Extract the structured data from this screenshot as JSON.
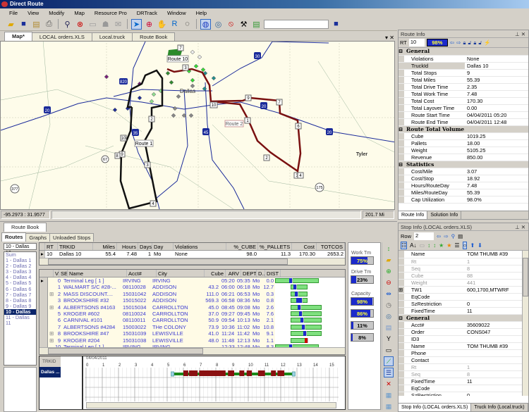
{
  "app": {
    "title": "Direct Route"
  },
  "menu": [
    "File",
    "View",
    "Modify",
    "Map",
    "Resource Pro",
    "DRTrack",
    "Window",
    "Help"
  ],
  "toolbar": {
    "combo_value": ""
  },
  "doc_tabs": [
    "Map*",
    "LOCAL orders.XLS",
    "Local.truck",
    "Route Book"
  ],
  "map": {
    "labels": {
      "route10": "Route 10",
      "route1": "Route 1",
      "route2": "Route 2",
      "dallas": "Dallas",
      "tyler": "Tyler"
    },
    "shields": {
      "i30": "30",
      "i820": "820",
      "i20a": "20",
      "i20b": "20",
      "i20c": "20",
      "i35": "35",
      "i45": "45",
      "us67": "67",
      "us377": "377",
      "us175": "175"
    },
    "route1_stops": [
      "10",
      "9",
      "8",
      "3",
      "4",
      "6",
      "2",
      "1"
    ],
    "route2_stops": [
      "10",
      "9",
      "7",
      "1",
      "6",
      "2",
      "3",
      "4"
    ],
    "route10_stops": [
      "7",
      "3"
    ]
  },
  "status": {
    "coords": "-95.2973 : 31.9577",
    "scale": "201.7 Mi"
  },
  "route_info": {
    "title": "Route Info",
    "rt_label": "RT",
    "rt_value": "10",
    "cap_pct": "98%",
    "sections": [
      {
        "name": "General",
        "rows": [
          [
            "Violations",
            "None"
          ],
          [
            "TruckId",
            "Dallas 10"
          ],
          [
            "Total Stops",
            "9"
          ],
          [
            "Total Miles",
            "55.39"
          ],
          [
            "Total Drive Time",
            "2.35"
          ],
          [
            "Total Work Time",
            "7.48"
          ],
          [
            "Total Cost",
            "170.30"
          ],
          [
            "Total Layover Time",
            "0.00"
          ],
          [
            "Route Start Time",
            "04/04/2011 05:20"
          ],
          [
            "Route End Time",
            "04/04/2011 12:48"
          ]
        ]
      },
      {
        "name": "Route Total Volume",
        "rows": [
          [
            "Cube",
            "1019.25"
          ],
          [
            "Pallets",
            "18.00"
          ],
          [
            "Weight",
            "5105.25"
          ],
          [
            "Revenue",
            "850.00"
          ]
        ]
      },
      {
        "name": "Statistics",
        "rows": [
          [
            "Cost/Mile",
            "3.07"
          ],
          [
            "Cost/Stop",
            "18.92"
          ],
          [
            "Hours/RouteDay",
            "7.48"
          ],
          [
            "Miles/RouteDay",
            "55.39"
          ],
          [
            "Cap Utilization",
            "98.0%"
          ]
        ]
      }
    ],
    "tabs": [
      "Route Info",
      "Solution Info"
    ]
  },
  "stop_info": {
    "title": "Stop Info (LOCAL orders.XLS)",
    "row_label": "Row",
    "row_value": "2",
    "top_rows": [
      [
        "Name",
        "TOM THUMB #39",
        0
      ],
      [
        "Rt",
        "1",
        1
      ],
      [
        "Seq",
        "8",
        1
      ],
      [
        "Cube",
        "88",
        1
      ],
      [
        "Weight",
        "441",
        1
      ],
      [
        "TW1",
        "600,1700,MTWRF",
        0
      ],
      [
        "EqCode",
        "",
        0
      ],
      [
        "SzRestriction",
        "0",
        0
      ],
      [
        "FixedTime",
        "11",
        0
      ]
    ],
    "section": "General",
    "gen_rows": [
      [
        "Acct#",
        "35609022",
        0
      ],
      [
        "Order",
        "CONS047",
        0
      ],
      [
        "ID3",
        "",
        0
      ],
      [
        "Name",
        "TOM THUMB #39",
        0
      ],
      [
        "Phone",
        "",
        0
      ],
      [
        "Contact",
        "",
        0
      ],
      [
        "Rt",
        "1",
        1
      ],
      [
        "Seq",
        "8",
        1
      ],
      [
        "FixedTime",
        "11",
        0
      ],
      [
        "EqCode",
        "",
        0
      ],
      [
        "SzRestriction",
        "0",
        0
      ],
      [
        "MaxSplits",
        "",
        1
      ]
    ],
    "tabs": [
      "Stop Info (LOCAL orders.XLS)",
      "Truck Info (Local.truck)"
    ]
  },
  "route_book": {
    "title": "Route Book",
    "tabs": [
      "Routes",
      "Graphs",
      "Unloaded Stops"
    ],
    "selected": "10 - Dallas 10",
    "routes": [
      "Sum",
      "1 - Dallas 1",
      "2 - Dallas 2",
      "3 - Dallas 3",
      "4 - Dallas 4",
      "5 - Dallas 5",
      "6 - Dallas 6",
      "7 - Dallas 7",
      "8 - Dallas 8",
      "9 - Dallas 9",
      "10 - Dallas 10",
      "11 - Dallas 11"
    ],
    "route_cols": [
      "RT",
      "TRKID",
      "Miles",
      "Hours",
      "Days",
      "Day",
      "Violations",
      "%_CUBE",
      "%_PALLETS",
      "Cost",
      "TOTCOS"
    ],
    "route_row": [
      "10",
      "Dallas 10",
      "55.4",
      "7.48",
      "1",
      "Mo",
      "None",
      "98.0",
      "11.3",
      "170.30",
      "2653.2"
    ],
    "stop_cols": [
      "V",
      "SE",
      "Name",
      "Acct#",
      "City",
      "Cube",
      "ARV",
      "DEPT",
      "D...",
      "DIST"
    ],
    "stops": [
      [
        "0",
        "Terminal Leg [ 1 ]",
        "IRVING",
        "IRVING",
        "",
        "05:20",
        "05:35",
        "Mo",
        "0.0"
      ],
      [
        "1",
        "WALMART S/C #28-...",
        "08110028",
        "ADDISON",
        "43.2",
        "06:00",
        "06:18",
        "Mo",
        "12.7"
      ],
      [
        "2",
        "MASS  DISCOUNT....",
        "15031042",
        "ADDISON",
        "111.0",
        "06:21",
        "06:53",
        "Mo",
        "0.3"
      ],
      [
        "3",
        "BROOKSHIRE #32",
        "15015022",
        "ADDISON",
        "569.3",
        "06:58",
        "08:36",
        "Mo",
        "0.8"
      ],
      [
        "4",
        "ALBERTSONS #4163",
        "15015034",
        "CARROLLTON",
        "45.0",
        "08:45",
        "09:08",
        "Mo",
        "2.6"
      ],
      [
        "5",
        "KROGER #602",
        "08110024",
        "CARROLLTON",
        "37.0",
        "09:27",
        "09:45",
        "Mo",
        "7.6"
      ],
      [
        "6",
        "CARNIVAL #101",
        "08110011",
        "CARROLLTON",
        "50.9",
        "09:54",
        "10:13",
        "Mo",
        "2.1"
      ],
      [
        "7",
        "ALBERTSONS #4284",
        "15003022",
        "THe COLONY",
        "73.9",
        "10:36",
        "11:02",
        "Mo",
        "10.8"
      ],
      [
        "8",
        "BROOKSHIRE #47",
        "15031039",
        "LEWISVILLE",
        "41.0",
        "11:24",
        "11:42",
        "Mo",
        "9.1"
      ],
      [
        "9",
        "KROGER #204",
        "15031038",
        "LEWISVILLE",
        "48.0",
        "11:48",
        "12:13",
        "Mo",
        "1.1"
      ],
      [
        "10",
        "Terminal Leg [ 1 ]",
        "IRVING",
        "IRVING",
        "",
        "12:33",
        "12:48",
        "Mo",
        "8.3"
      ]
    ],
    "capacity": {
      "work_label": "Work Tm",
      "work": 75,
      "drive_label": "Drive Tm",
      "drive": 23,
      "cap_label": "Capacity",
      "caps": [
        98,
        86,
        11,
        8
      ]
    },
    "gantt": {
      "trkid_header": "TRKID",
      "truck": "Dallas ...",
      "date": "04/04/2011",
      "hours": [
        "0",
        "1",
        "2",
        "3",
        "4",
        "5",
        "6",
        "7",
        "8",
        "9",
        "10",
        "11",
        "12",
        "13",
        "14",
        "15"
      ],
      "start": 5.33,
      "end": 12.8,
      "stops": [
        [
          6,
          6.3
        ],
        [
          6.35,
          6.88
        ],
        [
          6.97,
          8.6
        ],
        [
          8.75,
          9.13
        ],
        [
          9.45,
          9.75
        ],
        [
          9.9,
          10.22
        ],
        [
          10.6,
          11.03
        ],
        [
          11.4,
          11.7
        ],
        [
          11.8,
          12.22
        ]
      ]
    }
  }
}
